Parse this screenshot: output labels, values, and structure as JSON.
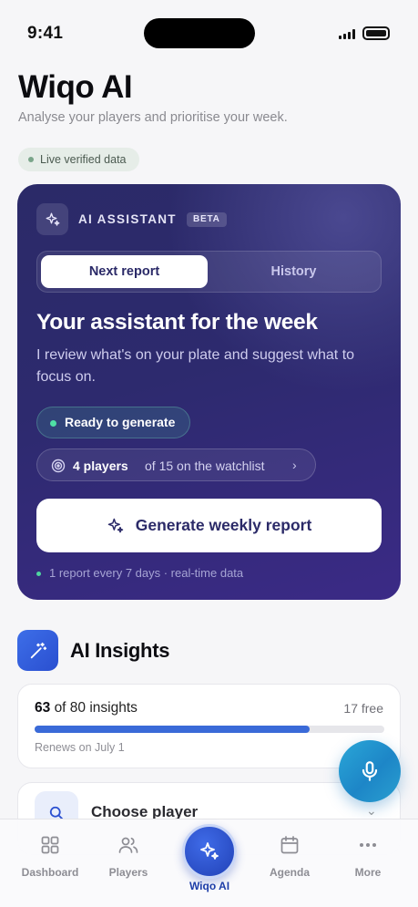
{
  "status_bar": {
    "time": "9:41"
  },
  "header": {
    "title": "Wiqo AI",
    "subtitle": "Analyse your players and prioritise your week.",
    "live_badge": "Live verified data"
  },
  "assistant": {
    "label": "AI ASSISTANT",
    "badge": "BETA",
    "tabs": [
      {
        "label": "Next report",
        "active": true
      },
      {
        "label": "History",
        "active": false
      }
    ],
    "title": "Your assistant for the week",
    "description": "I review what's on your plate and suggest what to focus on.",
    "status": "Ready to generate",
    "players_strong": "4 players",
    "players_rest": "of 15 on the watchlist",
    "generate_button": "Generate weekly report",
    "footnote": "1 report every 7 days · real-time data"
  },
  "insights": {
    "title": "AI Insights",
    "used": "63",
    "of_text": "of 80 insights",
    "free": "17 free",
    "progress": 0.7875,
    "renews": "Renews on July 1",
    "choose_player": "Choose player"
  },
  "tabbar": {
    "items": [
      {
        "label": "Dashboard",
        "icon": "grid-icon"
      },
      {
        "label": "Players",
        "icon": "users-icon"
      },
      {
        "label": "Wiqo AI",
        "icon": "sparkles-icon",
        "active": true
      },
      {
        "label": "Agenda",
        "icon": "calendar-icon"
      },
      {
        "label": "More",
        "icon": "more-icon"
      }
    ]
  },
  "colors": {
    "accent": "#2b2a68",
    "primary_blue": "#3a6ad8",
    "live_green": "#4fe0a5"
  }
}
